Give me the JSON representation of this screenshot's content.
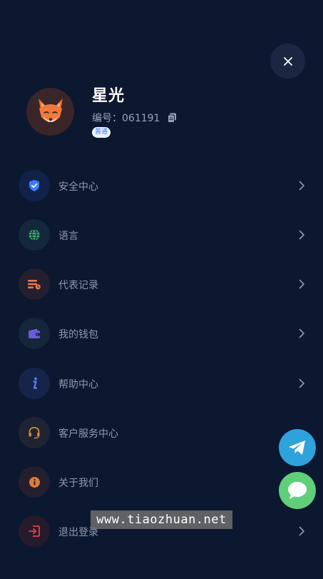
{
  "profile": {
    "name": "星光",
    "id_text": "编号：061191",
    "badge": "普通"
  },
  "menu": {
    "items": [
      {
        "label": "安全中心",
        "icon": "shield-icon",
        "icon_color": "#3d7bff",
        "bg_color": "#10224a",
        "has_chevron": true
      },
      {
        "label": "语言",
        "icon": "globe-icon",
        "icon_color": "#3fae6b",
        "bg_color": "#13283a",
        "has_chevron": true
      },
      {
        "label": "代表记录",
        "icon": "records-icon",
        "icon_color": "#e77b4c",
        "bg_color": "#231f2e",
        "has_chevron": true
      },
      {
        "label": "我的钱包",
        "icon": "wallet-icon",
        "icon_color": "#6b5bd8",
        "bg_color": "#15263b",
        "has_chevron": true
      },
      {
        "label": "帮助中心",
        "icon": "info-italic-icon",
        "icon_color": "#4f7ce8",
        "bg_color": "#16244a",
        "has_chevron": true
      },
      {
        "label": "客户服务中心",
        "icon": "headset-icon",
        "icon_color": "#d98a2f",
        "bg_color": "#1f2434",
        "has_chevron": false
      },
      {
        "label": "关于我们",
        "icon": "info-circle-icon",
        "icon_color": "#e07a3a",
        "bg_color": "#231f2e",
        "has_chevron": false
      },
      {
        "label": "退出登录",
        "icon": "logout-icon",
        "icon_color": "#e0434c",
        "bg_color": "#251b2c",
        "has_chevron": true
      }
    ]
  },
  "watermark": "www.tiaozhuan.net",
  "colors": {
    "background": "#0c1730",
    "label": "#8f99ae",
    "telegram": "#2ea3db",
    "chat": "#5fcf7a"
  }
}
